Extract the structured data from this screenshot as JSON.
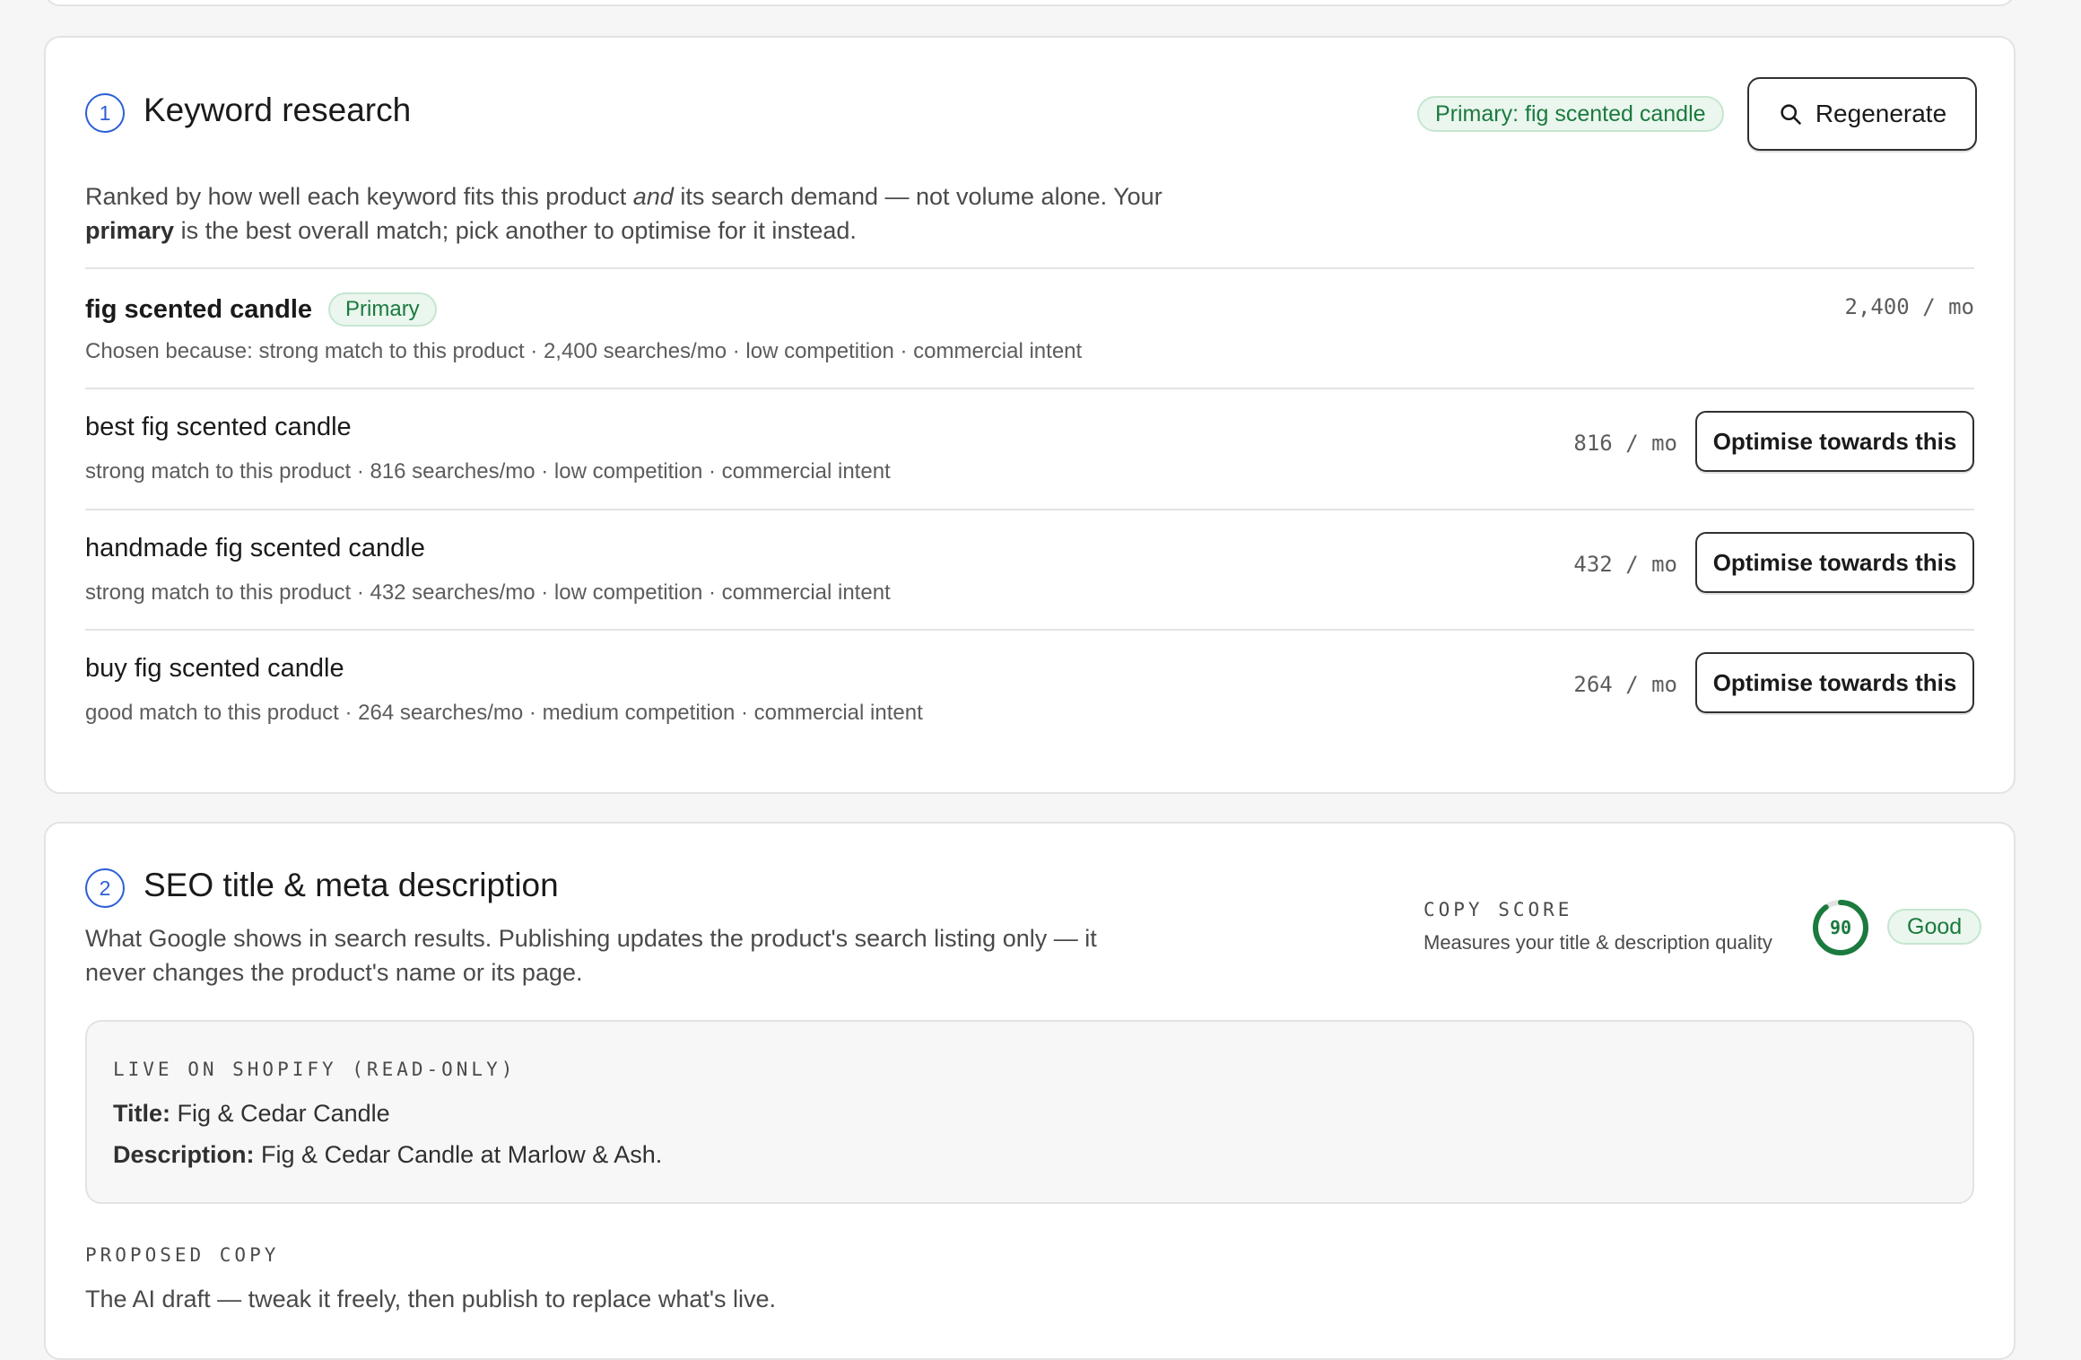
{
  "keyword_section": {
    "step": "1",
    "title": "Keyword research",
    "primary_chip": "Primary: fig scented candle",
    "regenerate_label": "Regenerate",
    "description_part1": "Ranked by how well each keyword fits this product ",
    "description_em": "and",
    "description_part2": " its search demand — not volume alone. Your ",
    "description_bold": "primary",
    "description_part3": " is the best overall match; pick another to optimise for it instead.",
    "keywords": [
      {
        "name": "fig scented candle",
        "badge": "Primary",
        "meta": "Chosen because: strong match to this product · 2,400 searches/mo · low competition · commercial intent",
        "volume": "2,400 / mo"
      },
      {
        "name": "best fig scented candle",
        "meta": "strong match to this product · 816 searches/mo · low competition · commercial intent",
        "volume": "816 / mo",
        "action": "Optimise towards this"
      },
      {
        "name": "handmade fig scented candle",
        "meta": "strong match to this product · 432 searches/mo · low competition · commercial intent",
        "volume": "432 / mo",
        "action": "Optimise towards this"
      },
      {
        "name": "buy fig scented candle",
        "meta": "good match to this product · 264 searches/mo · medium competition · commercial intent",
        "volume": "264 / mo",
        "action": "Optimise towards this"
      }
    ]
  },
  "seo_section": {
    "step": "2",
    "title": "SEO title & meta description",
    "description": "What Google shows in search results. Publishing updates the product's search listing only — it never changes the product's name or its page.",
    "copy_score": {
      "label": "COPY SCORE",
      "subtitle": "Measures your title & description quality",
      "value": "90",
      "score_fraction": 0.9,
      "rating": "Good"
    },
    "live": {
      "eyebrow": "LIVE ON SHOPIFY (READ-ONLY)",
      "title_label": "Title:",
      "title_value": "Fig & Cedar Candle",
      "description_label": "Description:",
      "description_value": "Fig & Cedar Candle at Marlow & Ash."
    },
    "proposed": {
      "eyebrow": "PROPOSED COPY",
      "hint": "The AI draft — tweak it freely, then publish to replace what's live."
    }
  },
  "colors": {
    "accent_blue": "#2c5fd7",
    "success_green": "#1b7a3e",
    "success_bg": "#eaf6ee"
  }
}
